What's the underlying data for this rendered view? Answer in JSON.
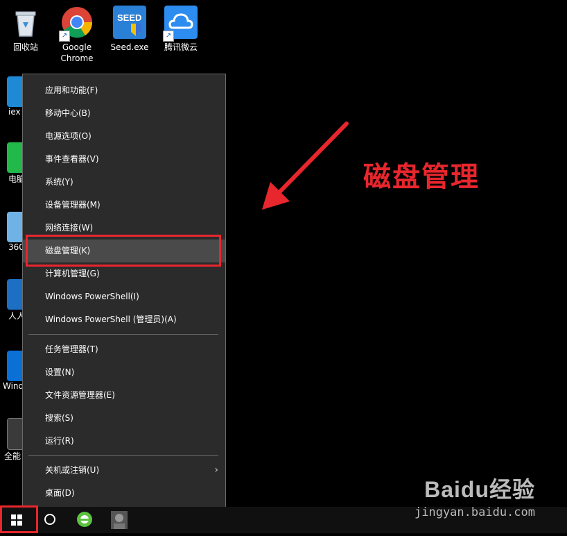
{
  "desktop": {
    "top_icons": [
      {
        "label": "回收站",
        "icon": "recycle-bin-icon"
      },
      {
        "label": "Google Chrome",
        "icon": "chrome-icon"
      },
      {
        "label": "Seed.exe",
        "icon": "seed-icon"
      },
      {
        "label": "腾讯微云",
        "icon": "weiyun-icon"
      }
    ],
    "left_icons": [
      {
        "label": "iex",
        "icon": "ie-icon"
      },
      {
        "label": "电脑",
        "icon": "wechat-icon"
      },
      {
        "label": "360",
        "icon": "folder-icon"
      },
      {
        "label": "人人",
        "icon": "renren-icon"
      },
      {
        "label": "Windo",
        "icon": "windows-icon"
      },
      {
        "label": "全能",
        "icon": "video-icon"
      }
    ]
  },
  "context_menu": {
    "group1": [
      "应用和功能(F)",
      "移动中心(B)",
      "电源选项(O)",
      "事件查看器(V)",
      "系统(Y)",
      "设备管理器(M)",
      "网络连接(W)",
      "磁盘管理(K)",
      "计算机管理(G)",
      "Windows PowerShell(I)",
      "Windows PowerShell (管理员)(A)"
    ],
    "group2": [
      "任务管理器(T)",
      "设置(N)",
      "文件资源管理器(E)",
      "搜索(S)",
      "运行(R)"
    ],
    "group3": [
      "关机或注销(U)",
      "桌面(D)"
    ],
    "selected": "磁盘管理(K)"
  },
  "annotation": {
    "text": "磁盘管理",
    "color": "#e8262d"
  },
  "watermark": {
    "brand": "Baidu经验",
    "url": "jingyan.baidu.com"
  },
  "taskbar": {
    "items": [
      "windows-start-icon",
      "cortana-circle-icon",
      "browser-icon",
      "app-avatar-icon"
    ]
  }
}
